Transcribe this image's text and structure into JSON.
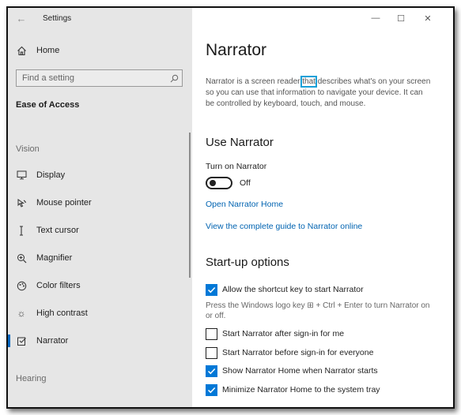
{
  "window": {
    "title": "Settings",
    "controls": {
      "minimize": "—",
      "maximize": "☐",
      "close": "✕"
    }
  },
  "sidebar": {
    "home_label": "Home",
    "search": {
      "placeholder": "Find a setting"
    },
    "category": "Ease of Access",
    "groups": [
      {
        "label": "Vision"
      },
      {
        "label": "Hearing"
      }
    ],
    "items": [
      {
        "label": "Display",
        "icon": "display-icon"
      },
      {
        "label": "Mouse pointer",
        "icon": "mouse-pointer-icon"
      },
      {
        "label": "Text cursor",
        "icon": "text-cursor-icon"
      },
      {
        "label": "Magnifier",
        "icon": "magnifier-icon"
      },
      {
        "label": "Color filters",
        "icon": "color-filters-icon"
      },
      {
        "label": "High contrast",
        "icon": "high-contrast-icon"
      },
      {
        "label": "Narrator",
        "icon": "narrator-icon",
        "selected": true
      }
    ]
  },
  "main": {
    "title": "Narrator",
    "description_before": "Narrator is a screen reader ",
    "description_highlight": "that",
    "description_after": " describes what's on your screen so you can use that information to navigate your device. It can be controlled by keyboard, touch, and mouse.",
    "use_section": {
      "title": "Use Narrator",
      "toggle_label": "Turn on Narrator",
      "toggle_state": "Off",
      "toggle_on": false,
      "link_home": "Open Narrator Home",
      "link_guide": "View the complete guide to Narrator online"
    },
    "startup_section": {
      "title": "Start-up options",
      "shortcut_label": "Allow the shortcut key to start Narrator",
      "shortcut_checked": true,
      "shortcut_help": "Press the Windows logo key ⊞ + Ctrl + Enter to turn Narrator on or off.",
      "options": [
        {
          "label": "Start Narrator after sign-in for me",
          "checked": false
        },
        {
          "label": "Start Narrator before sign-in for everyone",
          "checked": false
        },
        {
          "label": "Show Narrator Home when Narrator starts",
          "checked": true
        },
        {
          "label": "Minimize Narrator Home to the system tray",
          "checked": true
        }
      ]
    }
  },
  "colors": {
    "accent": "#0078d7",
    "link": "#0063b1",
    "sidebar_bg": "#e6e6e6",
    "highlight_box": "#18a0d8"
  }
}
